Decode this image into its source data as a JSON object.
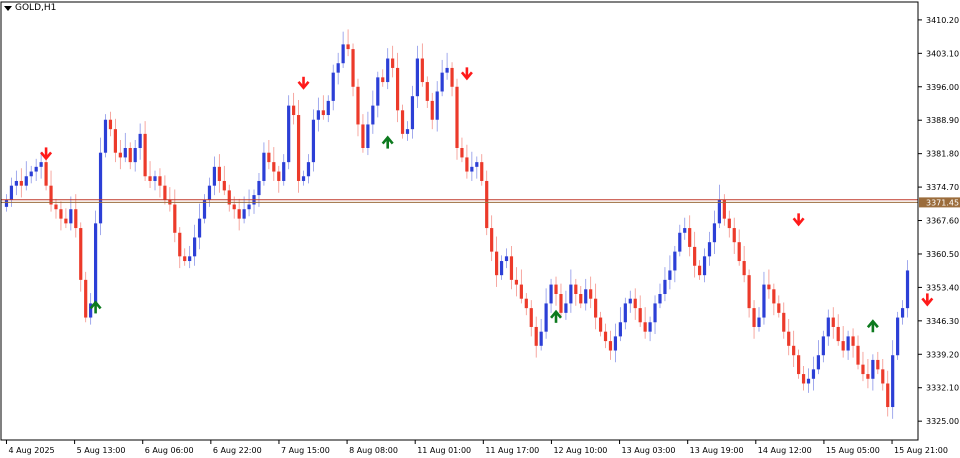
{
  "symbol": {
    "label": "GOLD,H1"
  },
  "chart_data": {
    "type": "candlestick",
    "title": "GOLD,H1",
    "ylim": [
      3321.0,
      3414.0
    ],
    "y_ticks": [
      "3410.20",
      "3403.10",
      "3396.00",
      "3388.90",
      "3381.80",
      "3374.70",
      "3367.60",
      "3360.50",
      "3353.40",
      "3346.30",
      "3339.20",
      "3332.10",
      "3325.00"
    ],
    "x_ticks": [
      {
        "label": "4 Aug 2025",
        "x": 0
      },
      {
        "label": "5 Aug 13:00",
        "x": 10
      },
      {
        "label": "6 Aug 06:00",
        "x": 20
      },
      {
        "label": "6 Aug 22:00",
        "x": 30
      },
      {
        "label": "7 Aug 15:00",
        "x": 40
      },
      {
        "label": "8 Aug 08:00",
        "x": 50
      },
      {
        "label": "11 Aug 01:00",
        "x": 60
      },
      {
        "label": "11 Aug 17:00",
        "x": 70
      },
      {
        "label": "12 Aug 10:00",
        "x": 80
      },
      {
        "label": "13 Aug 03:00",
        "x": 90
      },
      {
        "label": "13 Aug 19:00",
        "x": 100
      },
      {
        "label": "14 Aug 12:00",
        "x": 110
      },
      {
        "label": "15 Aug 05:00",
        "x": 120
      },
      {
        "label": "15 Aug 21:00",
        "x": 130
      }
    ],
    "price_line": {
      "value": 3371.45,
      "label": "3371.45"
    },
    "support_line": {
      "value": 3372.0
    },
    "closes": [
      3372,
      3375,
      3376,
      3375,
      3377,
      3378,
      3379,
      3380,
      3375,
      3371,
      3370,
      3368,
      3367,
      3370,
      3366,
      3355,
      3347,
      3350,
      3367,
      3382,
      3389,
      3387,
      3382,
      3381,
      3383,
      3380,
      3383,
      3386,
      3377,
      3376,
      3377,
      3375,
      3372,
      3371,
      3365,
      3360,
      3359,
      3360,
      3364,
      3368,
      3372,
      3375,
      3379,
      3376,
      3374,
      3371,
      3370,
      3368,
      3370,
      3371,
      3373,
      3376,
      3382,
      3380,
      3378,
      3376,
      3380,
      3392,
      3390,
      3376,
      3377,
      3380,
      3389,
      3391,
      3390,
      3393,
      3399,
      3401,
      3405,
      3404,
      3396,
      3388,
      3383,
      3388,
      3392,
      3398,
      3397,
      3402,
      3400,
      3391,
      3386,
      3387,
      3394,
      3402,
      3397,
      3393,
      3389,
      3395,
      3399,
      3400,
      3396,
      3383,
      3381,
      3378,
      3379,
      3380,
      3376,
      3366,
      3361,
      3356,
      3359,
      3360,
      3355,
      3354,
      3351,
      3349,
      3345,
      3341,
      3344,
      3350,
      3354,
      3352,
      3348,
      3350,
      3354,
      3352,
      3350,
      3353,
      3351,
      3347,
      3344,
      3342,
      3340,
      3343,
      3346,
      3350,
      3351,
      3349,
      3346,
      3344,
      3346,
      3350,
      3352,
      3355,
      3357,
      3361,
      3365,
      3366,
      3362,
      3358,
      3356,
      3360,
      3363,
      3367,
      3372,
      3368,
      3366,
      3363,
      3359,
      3356,
      3349,
      3345,
      3347,
      3354,
      3353,
      3350,
      3348,
      3344,
      3341,
      3339,
      3335,
      3333,
      3334,
      3336,
      3339,
      3343,
      3347,
      3345,
      3342,
      3340,
      3343,
      3341,
      3337,
      3335,
      3334,
      3338,
      3336,
      3333,
      3328,
      3339,
      3347,
      3349,
      3357
    ]
  },
  "signals": [
    {
      "name": "sell-arrow",
      "index": 8,
      "price": 3381,
      "dir": "down"
    },
    {
      "name": "buy-arrow",
      "index": 18,
      "price": 3350,
      "dir": "up"
    },
    {
      "name": "sell-arrow",
      "index": 60,
      "price": 3396,
      "dir": "down"
    },
    {
      "name": "buy-arrow",
      "index": 77,
      "price": 3385,
      "dir": "up"
    },
    {
      "name": "sell-arrow",
      "index": 93,
      "price": 3398,
      "dir": "down"
    },
    {
      "name": "buy-arrow",
      "index": 111,
      "price": 3348,
      "dir": "up"
    },
    {
      "name": "sell-arrow",
      "index": 160,
      "price": 3367,
      "dir": "down"
    },
    {
      "name": "buy-arrow",
      "index": 175,
      "price": 3346,
      "dir": "up"
    },
    {
      "name": "sell-arrow",
      "index": 186,
      "price": 3350,
      "dir": "down"
    }
  ],
  "colors": {
    "bull": "#2c3fd6",
    "bear": "#ec3a2a",
    "buy_arrow": "#0d7a1e",
    "sell_arrow": "#ff1a1a",
    "price_line": "#9b6c3b",
    "grid_axis": "#000000"
  }
}
